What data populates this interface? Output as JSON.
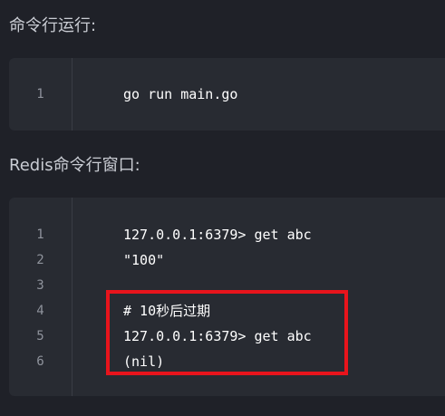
{
  "sections": [
    {
      "heading": "命令行运行:",
      "lines": [
        {
          "number": "1",
          "code": "go run main.go"
        }
      ]
    },
    {
      "heading": "Redis命令行窗口:",
      "lines": [
        {
          "number": "1",
          "code": "127.0.0.1:6379> get abc"
        },
        {
          "number": "2",
          "code": "\"100\""
        },
        {
          "number": "3",
          "code": ""
        },
        {
          "number": "4",
          "code": "# 10秒后过期"
        },
        {
          "number": "5",
          "code": "127.0.0.1:6379> get abc"
        },
        {
          "number": "6",
          "code": "(nil)"
        }
      ]
    }
  ],
  "colors": {
    "page_background": "#1f2128",
    "code_background": "#282b32",
    "highlight_border": "#e8141c"
  }
}
